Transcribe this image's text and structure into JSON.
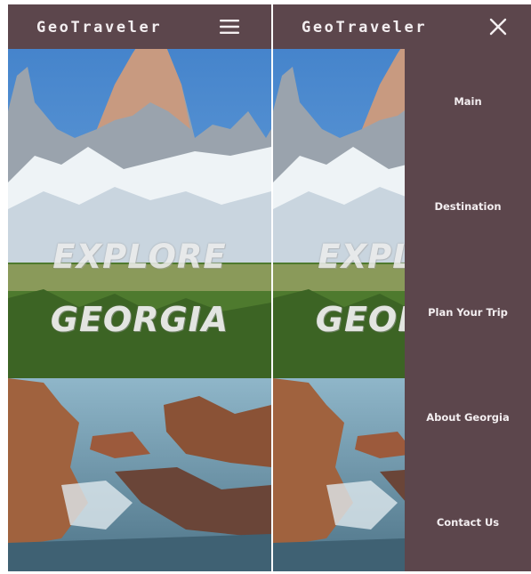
{
  "app": {
    "brand": "GeoTraveler"
  },
  "header": {
    "menu_open_icon": "hamburger-menu-icon",
    "menu_close_icon": "close-icon"
  },
  "hero": {
    "line1": "EXPLORE",
    "line2": "GEORGIA"
  },
  "menu": {
    "items": [
      {
        "label": "Main"
      },
      {
        "label": "Destination"
      },
      {
        "label": "Plan Your Trip"
      },
      {
        "label": "About Georgia"
      },
      {
        "label": "Contact Us"
      }
    ]
  },
  "colors": {
    "navbar": "#5c464c",
    "menu_text": "#f3eef0",
    "hero_text": "#ececec"
  }
}
